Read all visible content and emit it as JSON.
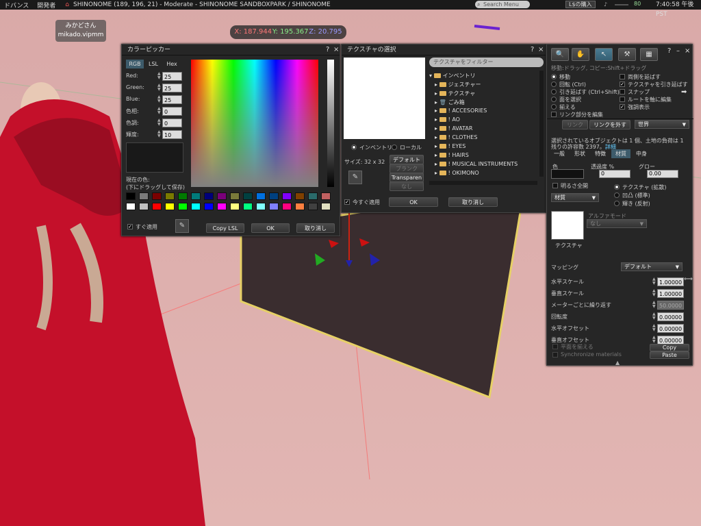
{
  "topbar": {
    "menu1": "ドバンス",
    "menu2": "開発者",
    "location": "SHINONOME (189, 196, 21) - Moderate - SHINONOME SANDBOXPARK / SHINONOME",
    "search_placeholder": "Search Menu",
    "buy": "L$の購入",
    "volume": "80",
    "clock": "7:40:58 午後 PST"
  },
  "nametag": {
    "line1": "みかどさん",
    "line2": "mikado.vipmm"
  },
  "coords": {
    "x": "X: 187.944",
    "y": "Y: 195.367",
    "z": "Z: 20.795"
  },
  "colorpicker": {
    "title": "カラーピッカー",
    "tabs": [
      "RGB",
      "LSL",
      "Hex"
    ],
    "fields": [
      {
        "label": "Red:",
        "value": "25"
      },
      {
        "label": "Green:",
        "value": "25"
      },
      {
        "label": "Blue:",
        "value": "25"
      },
      {
        "label": "色相:",
        "value": "0"
      },
      {
        "label": "色調:",
        "value": "0"
      },
      {
        "label": "輝度:",
        "value": "10"
      }
    ],
    "current_label1": "現在の色:",
    "current_label2": "(下にドラッグして保存)",
    "swatches_row1": [
      "#000000",
      "#7a7a7a",
      "#7a0000",
      "#7a7a00",
      "#007a00",
      "#007a7a",
      "#00007a",
      "#7a007a",
      "#7a7a3a",
      "#004040",
      "#0070e0",
      "#004080",
      "#8000ff",
      "#804000",
      "#2a6a6a",
      "#c06060"
    ],
    "swatches_row2": [
      "#ffffff",
      "#c0c0c0",
      "#ff0000",
      "#ffff00",
      "#00ff00",
      "#00ffff",
      "#0000ff",
      "#ff00ff",
      "#ffff80",
      "#00ff80",
      "#80ffff",
      "#8080ff",
      "#ff0080",
      "#ff8040",
      "#404040",
      "#e0e0c0"
    ],
    "apply_now": "すぐ適用",
    "copy_lsl": "Copy LSL",
    "ok": "OK",
    "cancel": "取り消し"
  },
  "texture": {
    "title": "テクスチャの選択",
    "filter_placeholder": "テクスチャをフィルター",
    "radio_inventory": "インベントリ",
    "radio_local": "ローカル",
    "size": "サイズ: 32 x 32",
    "btn_default": "デフォルト",
    "btn_blank": "ブランク",
    "btn_transparent": "Transparen",
    "btn_none": "なし",
    "root": "インベントリ",
    "items": [
      "ジェスチャー",
      "テクスチャ",
      "ごみ箱",
      "! ACCESORIES",
      "! AO",
      "! AVATAR",
      "! CLOTHES",
      "! EYES",
      "! HAIRS",
      "! MUSICAL INSTRUMENTS",
      "! OKIMONO"
    ],
    "apply_now": "今すぐ適用",
    "ok": "OK",
    "cancel": "取り消し"
  },
  "build": {
    "hint": "移動:ドラッグ, コピー:Shift+ドラッグ",
    "left_opts": [
      "移動",
      "回転 (Ctrl)",
      "引き延ばす (Ctrl+Shift)",
      "面を選択",
      "揃える",
      "リンク部分を編集"
    ],
    "right_opts": [
      "両側を延ばす",
      "テクスチャを引き延ばす",
      "スナップ",
      "ルートを軸に編集",
      "強調表示"
    ],
    "link": "リンク",
    "unlink": "リンクを外す",
    "world": "世界",
    "info1": "選択されているオブジェクトは 1 個、土地の負荷は 1",
    "info2": "残りの許容数 2397。",
    "detail": "詳細",
    "tabs": [
      "一般",
      "形状",
      "特徴",
      "材質",
      "中身"
    ],
    "color": "色",
    "transparency": "透過度 %",
    "transparency_val": "0",
    "glow": "グロー",
    "glow_val": "0.00",
    "fullbright": "明るさ全開",
    "material": "材質",
    "tex_radio": [
      "テクスチャ (拡散)",
      "凹凸 (標準)",
      "輝き (反射)"
    ],
    "alpha_mode": "アルファモード",
    "alpha_val": "なし",
    "texture_label": "テクスチャ",
    "mapping": "マッピング",
    "mapping_val": "デフォルト",
    "rows": [
      {
        "label": "水平スケール",
        "value": "1.00000"
      },
      {
        "label": "垂直スケール",
        "value": "1.00000"
      },
      {
        "label": "メーターごとに繰り返す",
        "value": "50.0000"
      },
      {
        "label": "回転度",
        "value": "0.00000"
      },
      {
        "label": "水平オフセット",
        "value": "0.00000"
      },
      {
        "label": "垂直オフセット",
        "value": "0.00000"
      }
    ],
    "align_plane": "平面を揃える",
    "sync": "Synchronize materials",
    "copy": "Copy",
    "paste": "Paste"
  }
}
